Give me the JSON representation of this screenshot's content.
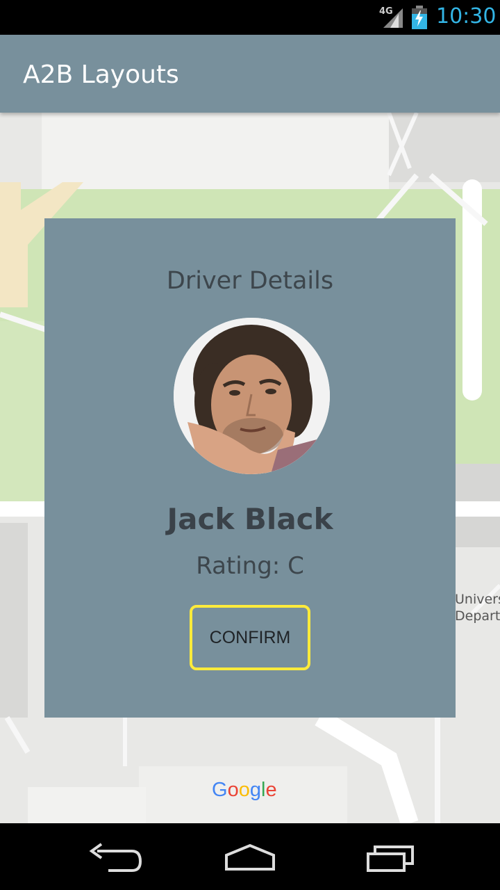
{
  "status_bar": {
    "network": "4G",
    "time": "10:30",
    "clock_color": "#33b5e5"
  },
  "app_bar": {
    "title": "A2B Layouts",
    "color": "#78909c"
  },
  "map": {
    "poi_label_line1": "Universit",
    "poi_label_line2": "Departm",
    "attribution": "Google"
  },
  "driver_card": {
    "heading": "Driver Details",
    "driver_name": "Jack Black",
    "rating": "Rating: C",
    "confirm_label": "CONFIRM",
    "accent_color": "#ffeb3b",
    "card_color": "#78909c"
  },
  "nav_bar": {
    "icons": [
      "back-icon",
      "home-icon",
      "recents-icon"
    ]
  }
}
